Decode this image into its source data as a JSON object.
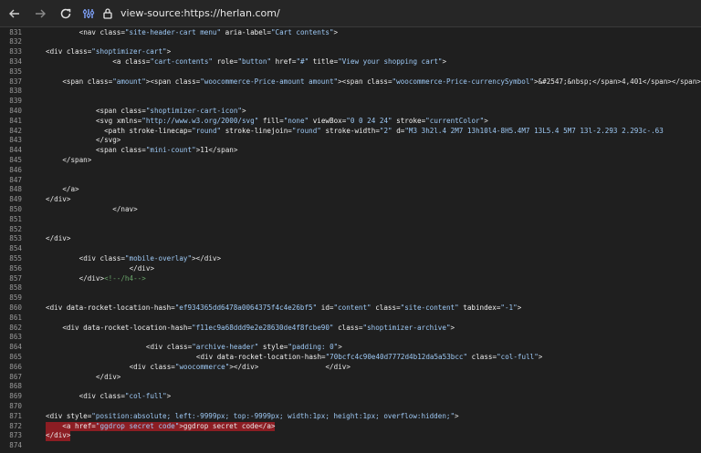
{
  "browser": {
    "url": "view-source:https://herlan.com/",
    "nav": {
      "back": "back-arrow",
      "forward": "forward-arrow",
      "reload": "reload-icon"
    }
  },
  "source_lines": [
    {
      "n": "831",
      "ind": 8,
      "parts": [
        [
          "<nav ",
          "t"
        ],
        [
          "class=",
          "a"
        ],
        [
          "\"site-header-cart menu\"",
          "v"
        ],
        [
          " aria-label=",
          "a"
        ],
        [
          "\"Cart contents\"",
          "v"
        ],
        [
          ">",
          "t"
        ]
      ]
    },
    {
      "n": "832",
      "ind": 0,
      "parts": []
    },
    {
      "n": "833",
      "ind": 0,
      "parts": [
        [
          "<div ",
          "t"
        ],
        [
          "class=",
          "a"
        ],
        [
          "\"shoptimizer-cart\"",
          "v"
        ],
        [
          ">",
          "t"
        ]
      ]
    },
    {
      "n": "834",
      "ind": 16,
      "parts": [
        [
          "<a ",
          "t"
        ],
        [
          "class=",
          "a"
        ],
        [
          "\"cart-contents\"",
          "v"
        ],
        [
          " role=",
          "a"
        ],
        [
          "\"button\"",
          "v"
        ],
        [
          " href=",
          "a"
        ],
        [
          "\"#\"",
          "v"
        ],
        [
          " title=",
          "a"
        ],
        [
          "\"View your shopping cart\"",
          "v"
        ],
        [
          ">",
          "t"
        ]
      ]
    },
    {
      "n": "835",
      "ind": 0,
      "parts": []
    },
    {
      "n": "837",
      "ind": 4,
      "parts": [
        [
          "<span ",
          "t"
        ],
        [
          "class=",
          "a"
        ],
        [
          "\"amount\"",
          "v"
        ],
        [
          "><span ",
          "t"
        ],
        [
          "class=",
          "a"
        ],
        [
          "\"woocommerce-Price-amount amount\"",
          "v"
        ],
        [
          "><span ",
          "t"
        ],
        [
          "class=",
          "a"
        ],
        [
          "\"woocommerce-Price-currencySymbol\"",
          "v"
        ],
        [
          ">&#2547;&nbsp;</span>4,401</span></span>",
          "t"
        ]
      ]
    },
    {
      "n": "838",
      "ind": 0,
      "parts": []
    },
    {
      "n": "839",
      "ind": 0,
      "parts": []
    },
    {
      "n": "840",
      "ind": 12,
      "parts": [
        [
          "<span ",
          "t"
        ],
        [
          "class=",
          "a"
        ],
        [
          "\"shoptimizer-cart-icon\"",
          "v"
        ],
        [
          ">",
          "t"
        ]
      ]
    },
    {
      "n": "841",
      "ind": 12,
      "parts": [
        [
          "<svg ",
          "t"
        ],
        [
          "xmlns=",
          "a"
        ],
        [
          "\"http://www.w3.org/2000/svg\"",
          "v"
        ],
        [
          " fill=",
          "a"
        ],
        [
          "\"none\"",
          "v"
        ],
        [
          " viewBox=",
          "a"
        ],
        [
          "\"0 0 24 24\"",
          "v"
        ],
        [
          " stroke=",
          "a"
        ],
        [
          "\"currentColor\"",
          "v"
        ],
        [
          ">",
          "t"
        ]
      ]
    },
    {
      "n": "842",
      "ind": 14,
      "parts": [
        [
          "<path ",
          "t"
        ],
        [
          "stroke-linecap=",
          "a"
        ],
        [
          "\"round\"",
          "v"
        ],
        [
          " stroke-linejoin=",
          "a"
        ],
        [
          "\"round\"",
          "v"
        ],
        [
          " stroke-width=",
          "a"
        ],
        [
          "\"2\"",
          "v"
        ],
        [
          " d=",
          "a"
        ],
        [
          "\"M3 3h2l.4 2M7 13h10l4-8H5.4M7 13L5.4 5M7 13l-2.293 2.293c-.63",
          "v"
        ]
      ]
    },
    {
      "n": "843",
      "ind": 12,
      "parts": [
        [
          "</svg>",
          "t"
        ]
      ]
    },
    {
      "n": "844",
      "ind": 12,
      "parts": [
        [
          "<span ",
          "t"
        ],
        [
          "class=",
          "a"
        ],
        [
          "\"mini-count\"",
          "v"
        ],
        [
          ">11</span>",
          "t"
        ]
      ]
    },
    {
      "n": "845",
      "ind": 4,
      "parts": [
        [
          "</span>",
          "t"
        ]
      ]
    },
    {
      "n": "846",
      "ind": 0,
      "parts": []
    },
    {
      "n": "847",
      "ind": 0,
      "parts": []
    },
    {
      "n": "848",
      "ind": 4,
      "parts": [
        [
          "</a>",
          "t"
        ]
      ]
    },
    {
      "n": "849",
      "ind": 0,
      "parts": [
        [
          "</div>",
          "t"
        ]
      ]
    },
    {
      "n": "850",
      "ind": 16,
      "parts": [
        [
          "</nav>",
          "t"
        ]
      ]
    },
    {
      "n": "851",
      "ind": 0,
      "parts": []
    },
    {
      "n": "852",
      "ind": 0,
      "parts": []
    },
    {
      "n": "853",
      "ind": 0,
      "parts": [
        [
          "</div>",
          "t"
        ]
      ]
    },
    {
      "n": "854",
      "ind": 0,
      "parts": []
    },
    {
      "n": "855",
      "ind": 8,
      "parts": [
        [
          "<div ",
          "t"
        ],
        [
          "class=",
          "a"
        ],
        [
          "\"mobile-overlay\"",
          "v"
        ],
        [
          "></div>",
          "t"
        ]
      ]
    },
    {
      "n": "856",
      "ind": 20,
      "parts": [
        [
          "</div>",
          "t"
        ]
      ]
    },
    {
      "n": "857",
      "ind": 8,
      "parts": [
        [
          "</div>",
          "t"
        ],
        [
          "<!--/h4-->",
          "c"
        ]
      ]
    },
    {
      "n": "858",
      "ind": 0,
      "parts": []
    },
    {
      "n": "859",
      "ind": 0,
      "parts": []
    },
    {
      "n": "860",
      "ind": 0,
      "parts": [
        [
          "<div ",
          "t"
        ],
        [
          "data-rocket-location-hash=",
          "a"
        ],
        [
          "\"ef934365dd6478a0064375f4c4e26bf5\"",
          "v"
        ],
        [
          " id=",
          "a"
        ],
        [
          "\"content\"",
          "v"
        ],
        [
          " class=",
          "a"
        ],
        [
          "\"site-content\"",
          "v"
        ],
        [
          " tabindex=",
          "a"
        ],
        [
          "\"-1\"",
          "v"
        ],
        [
          ">",
          "t"
        ]
      ]
    },
    {
      "n": "861",
      "ind": 0,
      "parts": []
    },
    {
      "n": "862",
      "ind": 4,
      "parts": [
        [
          "<div ",
          "t"
        ],
        [
          "data-rocket-location-hash=",
          "a"
        ],
        [
          "\"f11ec9a68ddd9e2e28630de4f8fcbe90\"",
          "v"
        ],
        [
          " class=",
          "a"
        ],
        [
          "\"shoptimizer-archive\"",
          "v"
        ],
        [
          ">",
          "t"
        ]
      ]
    },
    {
      "n": "863",
      "ind": 0,
      "parts": []
    },
    {
      "n": "864",
      "ind": 24,
      "parts": [
        [
          "<div ",
          "t"
        ],
        [
          "class=",
          "a"
        ],
        [
          "\"archive-header\"",
          "v"
        ],
        [
          " style=",
          "a"
        ],
        [
          "\"padding: 0\"",
          "v"
        ],
        [
          ">",
          "t"
        ]
      ]
    },
    {
      "n": "865",
      "ind": 36,
      "parts": [
        [
          "<div ",
          "t"
        ],
        [
          "data-rocket-location-hash=",
          "a"
        ],
        [
          "\"70bcfc4c90e40d7772d4b12da5a53bcc\"",
          "v"
        ],
        [
          " class=",
          "a"
        ],
        [
          "\"col-full\"",
          "v"
        ],
        [
          ">",
          "t"
        ]
      ]
    },
    {
      "n": "866",
      "ind": 20,
      "parts": [
        [
          "<div ",
          "t"
        ],
        [
          "class=",
          "a"
        ],
        [
          "\"woocommerce\"",
          "v"
        ],
        [
          "></div>                ",
          "t"
        ],
        [
          "</div>",
          "t"
        ]
      ]
    },
    {
      "n": "867",
      "ind": 12,
      "parts": [
        [
          "</div>",
          "t"
        ]
      ]
    },
    {
      "n": "868",
      "ind": 0,
      "parts": []
    },
    {
      "n": "869",
      "ind": 8,
      "parts": [
        [
          "<div ",
          "t"
        ],
        [
          "class=",
          "a"
        ],
        [
          "\"col-full\"",
          "v"
        ],
        [
          ">",
          "t"
        ]
      ]
    },
    {
      "n": "870",
      "ind": 0,
      "parts": []
    },
    {
      "n": "871",
      "ind": 0,
      "parts": [
        [
          "<div ",
          "t"
        ],
        [
          "style=",
          "a"
        ],
        [
          "\"position:absolute; left:-9999px; top:-9999px; width:1px; height:1px; overflow:hidden;\"",
          "v"
        ],
        [
          ">",
          "t"
        ]
      ]
    },
    {
      "n": "872",
      "ind": 0,
      "parts": [
        [
          "    <a ",
          "t"
        ],
        [
          "href=",
          "a"
        ],
        [
          "\"ggdrop secret code\"",
          "v"
        ],
        [
          ">ggdrop secret code</a>",
          "t"
        ]
      ],
      "hl": true
    },
    {
      "n": "873",
      "ind": 0,
      "parts": [
        [
          "</div>",
          "t"
        ]
      ],
      "hl": true
    },
    {
      "n": "874",
      "ind": 0,
      "parts": []
    }
  ]
}
